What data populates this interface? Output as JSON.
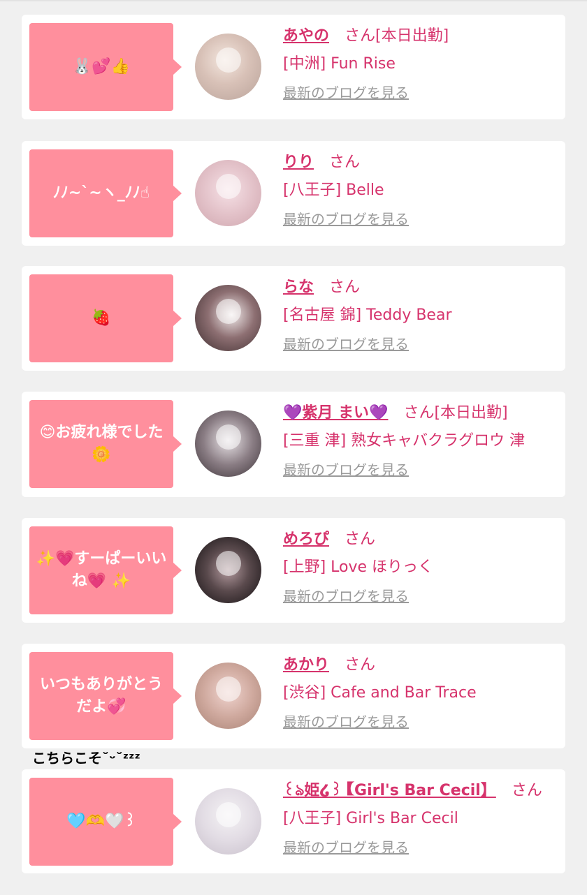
{
  "blog_link_label": "最新のブログを見る",
  "items": [
    {
      "message": "🐰💕👍",
      "name": "あやの",
      "honorific": "さん",
      "status": "[本日出勤]",
      "shop": "[中洲] Fun Rise",
      "avatar_colors": [
        "#f3e6de",
        "#b9a39a"
      ]
    },
    {
      "message": "ﾉﾉ~`~ヽ_ﾉﾉ☝",
      "name": "りり",
      "honorific": "さん",
      "status": "",
      "shop": "[八王子] Belle",
      "avatar_colors": [
        "#f6e1e6",
        "#cfa6ae"
      ]
    },
    {
      "message": "🍓",
      "name": "らな",
      "honorific": "さん",
      "status": "",
      "shop": "[名古屋 錦] Teddy Bear",
      "avatar_colors": [
        "#d9d0cf",
        "#3b2b2d"
      ]
    },
    {
      "message": "😊お疲れ様でした🌼",
      "name": "💜紫月 まい💜",
      "honorific": "さん",
      "status": "[本日出勤]",
      "shop": "[三重 津] 熟女キャバクラグロウ 津",
      "avatar_colors": [
        "#cfc6cc",
        "#3c3338"
      ]
    },
    {
      "message": "✨💗すーぱーいいね💗 ✨",
      "name": "めろぴ",
      "honorific": "さん",
      "status": "",
      "shop": "[上野] Love ほりっく",
      "avatar_colors": [
        "#5a4a4d",
        "#141012"
      ]
    },
    {
      "message": "いつもありがとうだよ💞",
      "name": "あかり",
      "honorific": "さん",
      "status": "",
      "shop": "[渋谷] Cafe and Bar Trace",
      "avatar_colors": [
        "#f0d4cf",
        "#a88275"
      ]
    },
    {
      "message": "🩵🫶🤍꒱",
      "name": "꒰ঌ姫໒꒱【Girl's Bar Cecil】",
      "honorific": "さん",
      "status": "",
      "shop": "[八王子] Girl's Bar Cecil",
      "avatar_colors": [
        "#f4f2f4",
        "#c9c1cc"
      ]
    }
  ],
  "between_text": "こちらこそ˘ᵕ˘ᶻᶻᶻ",
  "colors": {
    "page_bg": "#f0f0f0",
    "card_bg": "#ffffff",
    "bubble_bg": "#ff8f9d",
    "accent": "#d6336c",
    "link_gray": "#9a9a9a"
  }
}
